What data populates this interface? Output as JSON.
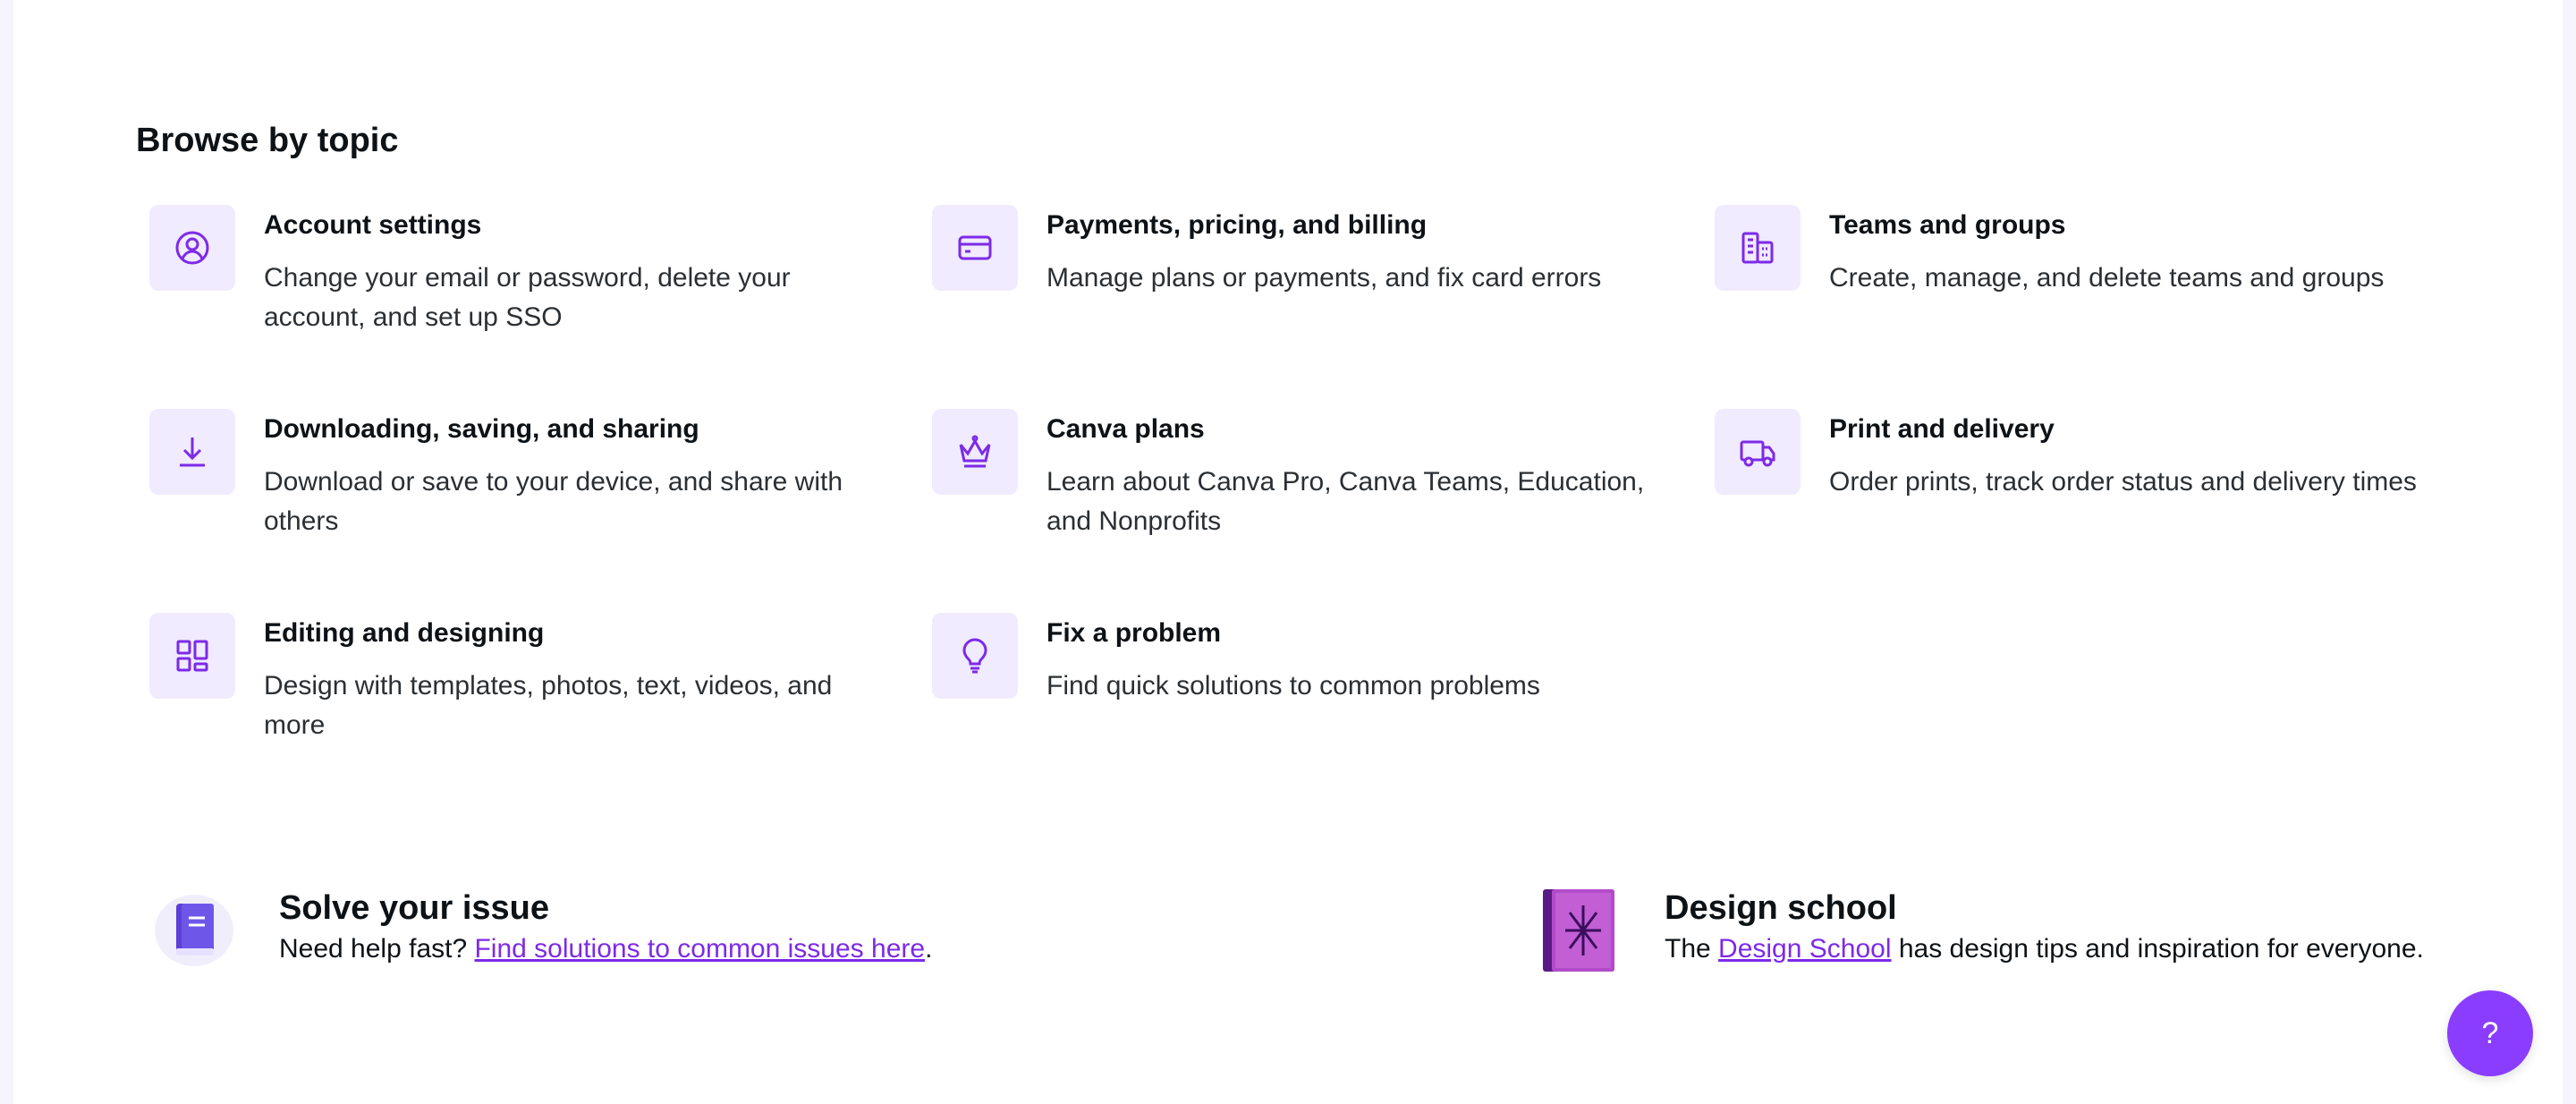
{
  "browse": {
    "title": "Browse by topic",
    "topics": [
      {
        "title": "Account settings",
        "desc": "Change your email or password, delete your account, and set up SSO",
        "icon": "account-circle-icon"
      },
      {
        "title": "Payments, pricing, and billing",
        "desc": "Manage plans or payments, and fix card errors",
        "icon": "credit-card-icon"
      },
      {
        "title": "Teams and groups",
        "desc": "Create, manage, and delete teams and groups",
        "icon": "building-icon"
      },
      {
        "title": "Downloading, saving, and sharing",
        "desc": "Download or save to your device, and share with others",
        "icon": "download-icon"
      },
      {
        "title": "Canva plans",
        "desc": "Learn about Canva Pro, Canva Teams, Education, and Nonprofits",
        "icon": "crown-icon"
      },
      {
        "title": "Print and delivery",
        "desc": "Order prints, track order status and delivery times",
        "icon": "truck-icon"
      },
      {
        "title": "Editing and designing",
        "desc": "Design with templates, photos, text, videos, and more",
        "icon": "layout-grid-icon"
      },
      {
        "title": "Fix a problem",
        "desc": "Find quick solutions to common problems",
        "icon": "lightbulb-icon"
      }
    ]
  },
  "solve": {
    "title": "Solve your issue",
    "prefix": "Need help fast? ",
    "link": "Find solutions to common issues here",
    "suffix": "."
  },
  "school": {
    "title": "Design school",
    "prefix": "The ",
    "link": "Design School",
    "suffix": " has design tips and inspiration for everyone."
  },
  "help_button": {
    "label": "?"
  },
  "colors": {
    "accent": "#8b3dff",
    "icon_bg": "#f0ebff",
    "link": "#7d2ae8"
  }
}
